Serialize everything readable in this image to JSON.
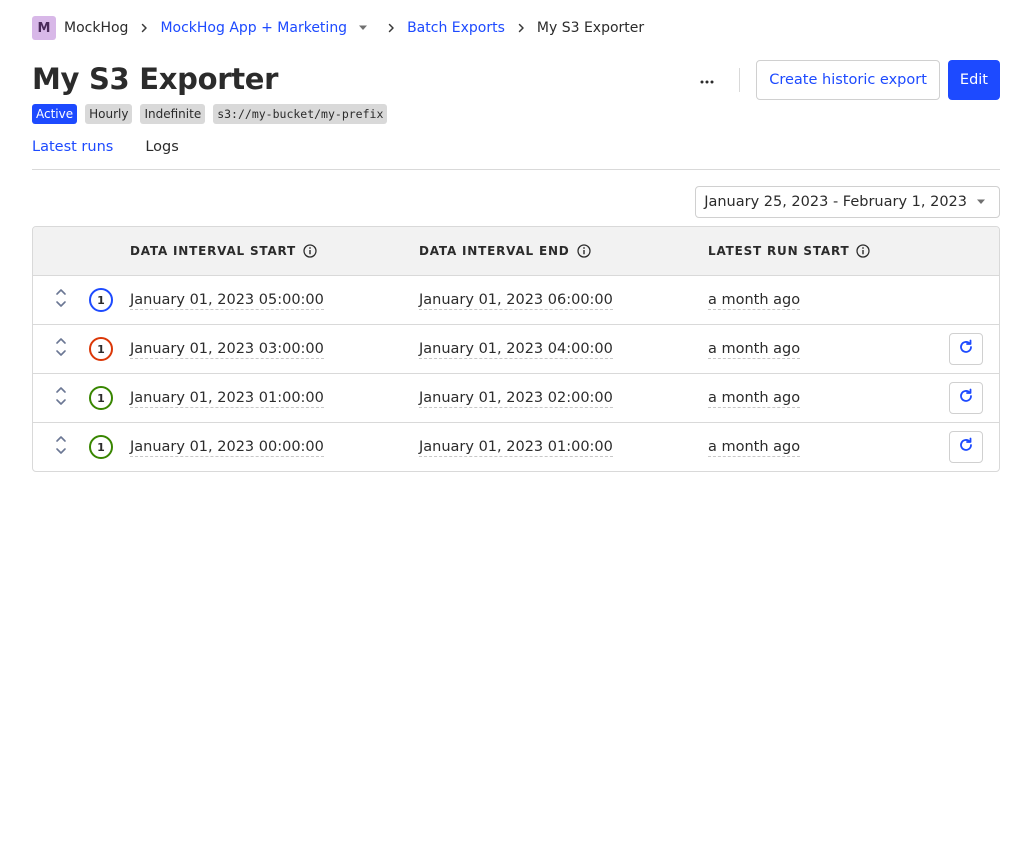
{
  "breadcrumbs": {
    "org_initial": "M",
    "org_name": "MockHog",
    "project": "MockHog App + Marketing",
    "section": "Batch Exports",
    "current": "My S3 Exporter"
  },
  "header": {
    "title": "My S3 Exporter",
    "tags": [
      "Active",
      "Hourly",
      "Indefinite",
      "s3://my-bucket/my-prefix"
    ],
    "more_icon": "ellipsis-icon",
    "create_historic_label": "Create historic export",
    "edit_label": "Edit"
  },
  "tabs": [
    {
      "label": "Latest runs",
      "active": true
    },
    {
      "label": "Logs",
      "active": false
    }
  ],
  "date_range": "January 25, 2023 - February 1, 2023",
  "table": {
    "columns": [
      "DATA INTERVAL START",
      "DATA INTERVAL END",
      "LATEST RUN START"
    ],
    "rows": [
      {
        "status_count": "1",
        "status": "running",
        "start": "January 01, 2023 05:00:00",
        "end": "January 01, 2023 06:00:00",
        "run_start": "a month ago",
        "retry": false
      },
      {
        "status_count": "1",
        "status": "failed",
        "start": "January 01, 2023 03:00:00",
        "end": "January 01, 2023 04:00:00",
        "run_start": "a month ago",
        "retry": true
      },
      {
        "status_count": "1",
        "status": "completed",
        "start": "January 01, 2023 01:00:00",
        "end": "January 01, 2023 02:00:00",
        "run_start": "a month ago",
        "retry": true
      },
      {
        "status_count": "1",
        "status": "completed",
        "start": "January 01, 2023 00:00:00",
        "end": "January 01, 2023 01:00:00",
        "run_start": "a month ago",
        "retry": true
      }
    ]
  },
  "colors": {
    "primary": "#1d4aff",
    "running": "#1d4aff",
    "failed": "#db3707",
    "completed": "#388600"
  }
}
